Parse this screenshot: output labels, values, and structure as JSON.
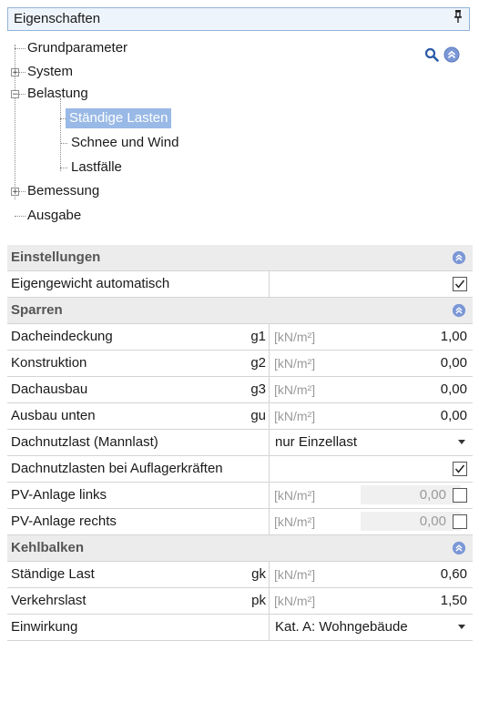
{
  "panel": {
    "title": "Eigenschaften",
    "pin_glyph": "p"
  },
  "tree": {
    "items": [
      {
        "label": "Grundparameter",
        "expander": ""
      },
      {
        "label": "System",
        "expander": "+"
      },
      {
        "label": "Belastung",
        "expander": "−"
      },
      {
        "label": "Ständige Lasten",
        "expander": "",
        "selected": true
      },
      {
        "label": "Schnee und Wind",
        "expander": ""
      },
      {
        "label": "Lastfälle",
        "expander": ""
      },
      {
        "label": "Bemessung",
        "expander": "+"
      },
      {
        "label": "Ausgabe",
        "expander": ""
      }
    ],
    "icons": [
      "search-icon",
      "collapse-all-icon"
    ]
  },
  "grid": {
    "einstellungen": {
      "title": "Einstellungen",
      "rows": [
        {
          "label": "Eigengewicht automatisch",
          "checked": true
        }
      ]
    },
    "sparren": {
      "title": "Sparren",
      "rows": [
        {
          "label": "Dacheindeckung",
          "symbol": "g1",
          "unit": "[kN/m²]",
          "value": "1,00"
        },
        {
          "label": "Konstruktion",
          "symbol": "g2",
          "unit": "[kN/m²]",
          "value": "0,00"
        },
        {
          "label": "Dachausbau",
          "symbol": "g3",
          "unit": "[kN/m²]",
          "value": "0,00"
        },
        {
          "label": "Ausbau unten",
          "symbol": "gu",
          "unit": "[kN/m²]",
          "value": "0,00"
        },
        {
          "label": "Dachnutzlast (Mannlast)",
          "selected_option": "nur Einzellast"
        },
        {
          "label": "Dachnutzlasten bei Auflagerkräften",
          "checked": true
        },
        {
          "label": "PV-Anlage links",
          "unit": "[kN/m²]",
          "value": "0,00",
          "checked": false
        },
        {
          "label": "PV-Anlage rechts",
          "unit": "[kN/m²]",
          "value": "0,00",
          "checked": false
        }
      ]
    },
    "kehlbalken": {
      "title": "Kehlbalken",
      "rows": [
        {
          "label": "Ständige Last",
          "symbol": "gk",
          "unit": "[kN/m²]",
          "value": "0,60"
        },
        {
          "label": "Verkehrslast",
          "symbol": "pk",
          "unit": "[kN/m²]",
          "value": "1,50"
        },
        {
          "label": "Einwirkung",
          "selected_option": "Kat. A: Wohngebäude"
        }
      ]
    }
  },
  "colors": {
    "accent": "#6d8fd1",
    "selection": "#99b9e6",
    "category_bg": "#ececec"
  }
}
